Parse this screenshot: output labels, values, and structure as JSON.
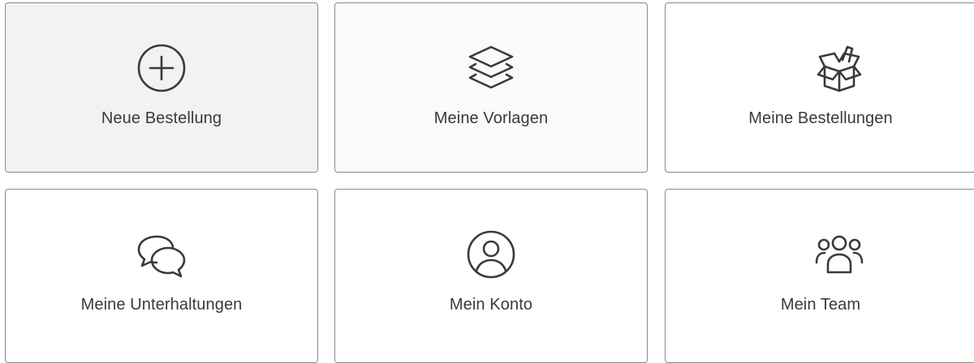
{
  "tiles": [
    {
      "label": "Neue Bestellung",
      "icon": "plus-circle-icon",
      "state": "active"
    },
    {
      "label": "Meine Vorlagen",
      "icon": "layers-icon",
      "state": "hover"
    },
    {
      "label": "Meine Bestellungen",
      "icon": "open-box-icon",
      "state": "default"
    },
    {
      "label": "Meine Unterhaltungen",
      "icon": "chat-bubbles-icon",
      "state": "default"
    },
    {
      "label": "Mein Konto",
      "icon": "user-circle-icon",
      "state": "default"
    },
    {
      "label": "Mein Team",
      "icon": "team-icon",
      "state": "default"
    }
  ],
  "colors": {
    "border": "#8a8a8a",
    "icon_stroke": "#3a3a3a",
    "active_background": "#f2f2f4"
  }
}
